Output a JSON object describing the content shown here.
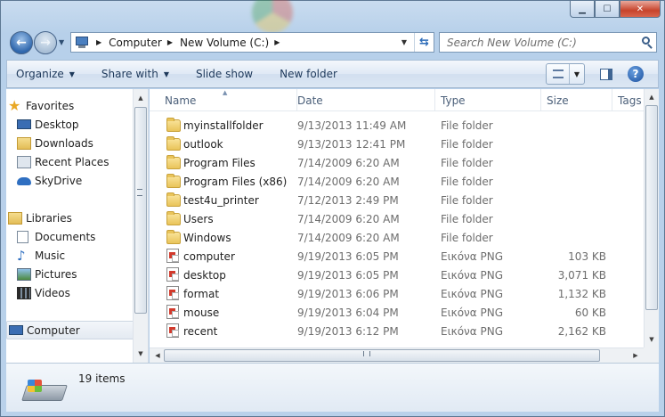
{
  "window": {
    "caption_buttons": [
      "minimize",
      "maximize",
      "close"
    ]
  },
  "navbar": {
    "breadcrumbs": [
      "Computer",
      "New Volume (C:)"
    ],
    "search_placeholder": "Search New Volume (C:)"
  },
  "toolbar": {
    "organize": "Organize",
    "share_with": "Share with",
    "slide_show": "Slide show",
    "new_folder": "New folder"
  },
  "sidebar": {
    "favorites": {
      "label": "Favorites",
      "items": [
        {
          "label": "Desktop",
          "icon": "desktop-icon"
        },
        {
          "label": "Downloads",
          "icon": "downloads-icon"
        },
        {
          "label": "Recent Places",
          "icon": "recent-places-icon"
        },
        {
          "label": "SkyDrive",
          "icon": "skydrive-icon"
        }
      ]
    },
    "libraries": {
      "label": "Libraries",
      "items": [
        {
          "label": "Documents",
          "icon": "documents-icon"
        },
        {
          "label": "Music",
          "icon": "music-icon"
        },
        {
          "label": "Pictures",
          "icon": "pictures-icon"
        },
        {
          "label": "Videos",
          "icon": "videos-icon"
        }
      ]
    },
    "computer": {
      "label": "Computer"
    }
  },
  "file_list": {
    "columns": [
      "Name",
      "Date",
      "Type",
      "Size",
      "Tags"
    ],
    "rows": [
      {
        "name": "myinstallfolder",
        "date": "9/13/2013 11:49 AM",
        "type": "File folder",
        "size": "",
        "icon": "folder-icon"
      },
      {
        "name": "outlook",
        "date": "9/13/2013 12:41 PM",
        "type": "File folder",
        "size": "",
        "icon": "folder-icon"
      },
      {
        "name": "Program Files",
        "date": "7/14/2009 6:20 AM",
        "type": "File folder",
        "size": "",
        "icon": "folder-icon"
      },
      {
        "name": "Program Files (x86)",
        "date": "7/14/2009 6:20 AM",
        "type": "File folder",
        "size": "",
        "icon": "folder-icon"
      },
      {
        "name": "test4u_printer",
        "date": "7/12/2013 2:49 PM",
        "type": "File folder",
        "size": "",
        "icon": "folder-icon"
      },
      {
        "name": "Users",
        "date": "7/14/2009 6:20 AM",
        "type": "File folder",
        "size": "",
        "icon": "folder-icon"
      },
      {
        "name": "Windows",
        "date": "7/14/2009 6:20 AM",
        "type": "File folder",
        "size": "",
        "icon": "folder-icon"
      },
      {
        "name": "computer",
        "date": "9/19/2013 6:05 PM",
        "type": "Εικόνα PNG",
        "size": "103 KB",
        "icon": "png-file-icon"
      },
      {
        "name": "desktop",
        "date": "9/19/2013 6:05 PM",
        "type": "Εικόνα PNG",
        "size": "3,071 KB",
        "icon": "png-file-icon"
      },
      {
        "name": "format",
        "date": "9/19/2013 6:06 PM",
        "type": "Εικόνα PNG",
        "size": "1,132 KB",
        "icon": "png-file-icon"
      },
      {
        "name": "mouse",
        "date": "9/19/2013 6:04 PM",
        "type": "Εικόνα PNG",
        "size": "60 KB",
        "icon": "png-file-icon"
      },
      {
        "name": "recent",
        "date": "9/19/2013 6:12 PM",
        "type": "Εικόνα PNG",
        "size": "2,162 KB",
        "icon": "png-file-icon"
      }
    ]
  },
  "status_bar": {
    "item_count": "19 items"
  }
}
